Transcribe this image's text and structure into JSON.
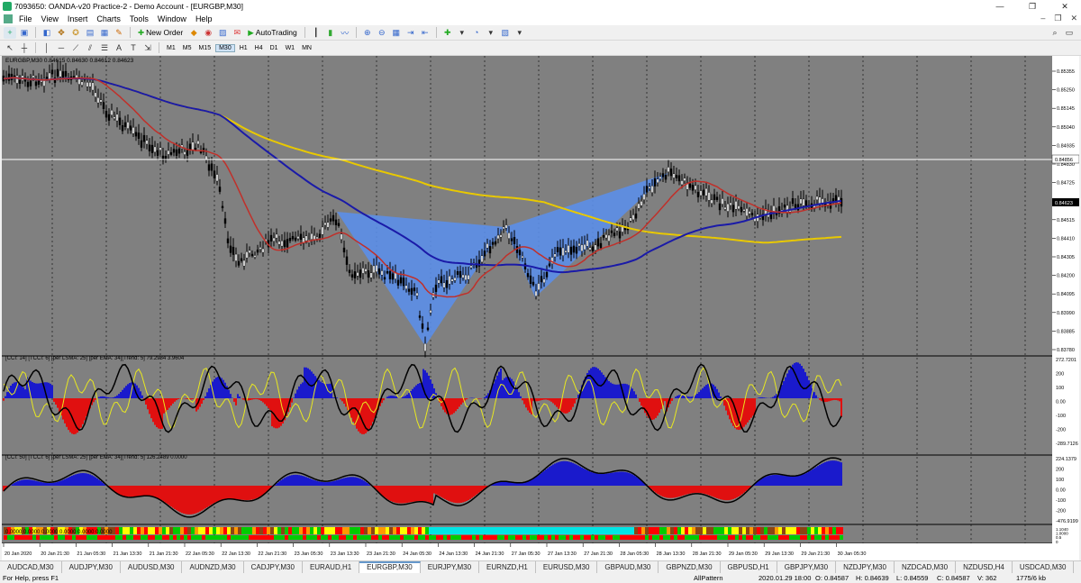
{
  "window": {
    "title": "7093650: OANDA-v20 Practice-2 - Demo Account - [EURGBP,M30]",
    "controls": [
      "—",
      "❐",
      "✕"
    ]
  },
  "menu": {
    "items": [
      "File",
      "View",
      "Insert",
      "Charts",
      "Tools",
      "Window",
      "Help"
    ]
  },
  "toolbar": {
    "new_order_label": "New Order",
    "autotrading_label": "AutoTrading",
    "timeframes": [
      "M1",
      "M5",
      "M15",
      "M30",
      "H1",
      "H4",
      "D1",
      "W1",
      "MN"
    ],
    "active_timeframe": "M30"
  },
  "chart": {
    "header": "EURGBP,M30  0.84615 0.84630 0.84612 0.84623",
    "price_labels": [
      "0.85355",
      "0.85250",
      "0.85145",
      "0.85040",
      "0.84935",
      "0.84830",
      "0.84725",
      "0.84620",
      "0.84515",
      "0.84410",
      "0.84305",
      "0.84200",
      "0.84095",
      "0.83990",
      "0.83885",
      "0.83780"
    ],
    "hline_label": "0.84856",
    "current_price_label": "0.84623",
    "indicator1_header": "[CCI: 14] [TCCI: 6] [per LSMA: 25] [per EMA: 34][Trend: 5]  79.2984 3.9604",
    "indicator1_levels": [
      "272.7201",
      "200",
      "100",
      "0.00",
      "-100",
      "-200",
      "-289.7126"
    ],
    "indicator2_header": "[CCI: 50] [TCCI: 6] [per LSMA: 25] [per EMA: 34][Trend: 5]  126.2489 0.0000",
    "indicator2_levels": [
      "224.1379",
      "200",
      "100",
      "0.00",
      "-100",
      "-200",
      "-476.9199"
    ],
    "indicator3_header": "0.0000 0.0000 0.0000 0.0000 0.0000 0.0000",
    "indicator3_levels": [
      "1.1040",
      "1.0000",
      "0.5",
      "0"
    ],
    "time_labels": [
      "20 Jan 2020",
      "20 Jan 21:30",
      "21 Jan 05:30",
      "21 Jan 13:30",
      "21 Jan 21:30",
      "22 Jan 05:30",
      "22 Jan 13:30",
      "22 Jan 21:30",
      "23 Jan 05:30",
      "23 Jan 13:30",
      "23 Jan 21:30",
      "24 Jan 05:30",
      "24 Jan 13:30",
      "24 Jan 21:30",
      "27 Jan 05:30",
      "27 Jan 13:30",
      "27 Jan 21:30",
      "28 Jan 05:30",
      "28 Jan 13:30",
      "28 Jan 21:30",
      "29 Jan 05:30",
      "29 Jan 13:30",
      "29 Jan 21:30",
      "30 Jan 05:30"
    ],
    "colors": {
      "background": "#808080",
      "candle": "#000000",
      "ma_fast": "#c0302a",
      "ma_mid": "#1a1aa8",
      "ma_slow": "#e8c800",
      "pattern": "#5b8ee8",
      "positive_hist": "#1a1acc",
      "negative_hist": "#e01010",
      "cci_line": "#e8e820"
    }
  },
  "tabs": [
    "AUDCAD,M30",
    "AUDJPY,M30",
    "AUDUSD,M30",
    "AUDNZD,M30",
    "CADJPY,M30",
    "EURAUD,H1",
    "EURGBP,M30",
    "EURJPY,M30",
    "EURNZD,H1",
    "EURUSD,M30",
    "GBPAUD,M30",
    "GBPNZD,M30",
    "GBPUSD,H1",
    "GBPJPY,M30",
    "NZDJPY,M30",
    "NZDCAD,M30",
    "NZDUSD,H4",
    "USDCAD,M30",
    "USDJPY,M30"
  ],
  "active_tab": "EURGBP,M30",
  "status": {
    "help": "For Help, press F1",
    "profile": "AllPattern",
    "datetime": "2020.01.29 18:00",
    "open": "O: 0.84587",
    "high": "H: 0.84639",
    "low": "L: 0.84559",
    "close": "C: 0.84587",
    "volume": "V: 362",
    "traffic": "1775/6 kb"
  }
}
